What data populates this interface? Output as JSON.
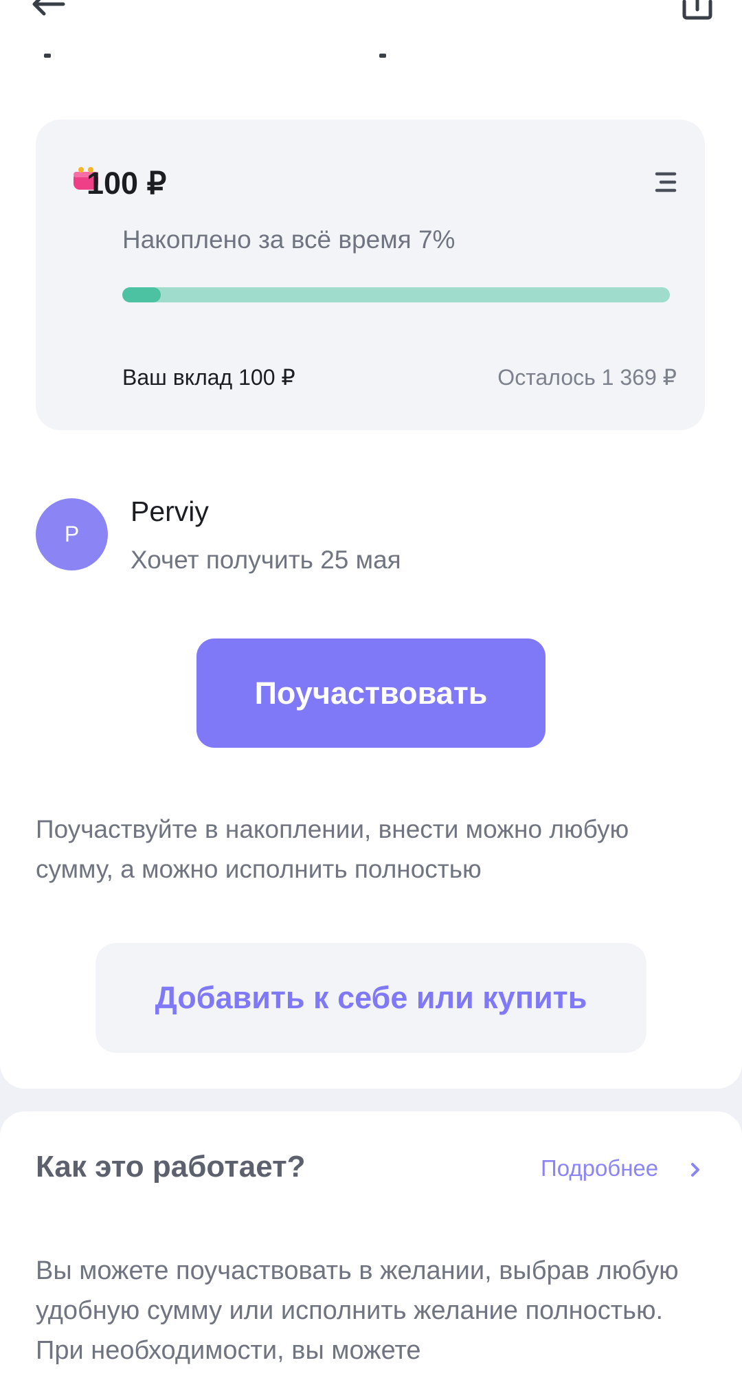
{
  "summary": {
    "amount": "100 ₽",
    "accumulated_text": "Накоплено за всё время 7%",
    "progress_percent": 7,
    "contribution_text": "Ваш вклад 100 ₽",
    "remaining_text": "Осталось 1 369 ₽"
  },
  "user": {
    "avatar_letter": "P",
    "name": "Perviy",
    "subtitle": "Хочет получить 25 мая"
  },
  "actions": {
    "participate_label": "Поучаствовать",
    "hint_text": "Поучаствуйте в накоплении, внести можно любую сумму, а можно исполнить полностью",
    "add_or_buy_label": "Добавить к себе или купить"
  },
  "how_it_works": {
    "title": "Как это работает?",
    "more_label": "Подробнее",
    "body": "Вы можете поучаствовать в желании, выбрав любую удобную сумму или исполнить желание полностью. При необходимости, вы можете"
  },
  "icons": {
    "back": "arrow-left-icon",
    "share": "share-icon",
    "wallet": "wallet-emoji-icon",
    "menu": "list-menu-icon",
    "chevron": "chevron-right-icon"
  },
  "colors": {
    "accent": "#7f79f7",
    "progress_track": "#9fdccb",
    "progress_fill": "#4cc2a3",
    "card_background": "#f3f4f8"
  }
}
